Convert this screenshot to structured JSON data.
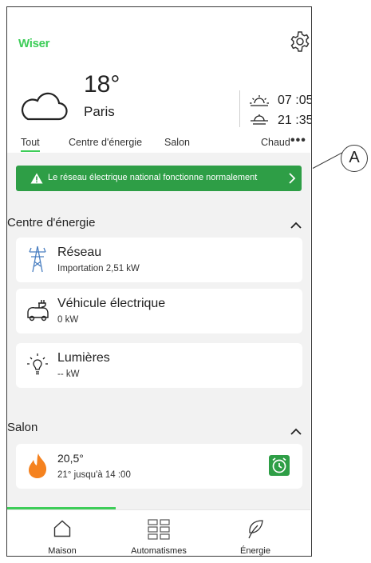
{
  "header": {
    "logo": "Wiser",
    "weather": {
      "icon": "cloud-icon",
      "temperature": "18°",
      "city": "Paris"
    },
    "sunrise": {
      "icon": "sunrise-icon",
      "time": "07 :05"
    },
    "sunset": {
      "icon": "sunset-icon",
      "time": "21 :35"
    },
    "settings_icon": "gear-icon"
  },
  "tabs": [
    {
      "label": "Tout",
      "active": true
    },
    {
      "label": "Centre d'énergie"
    },
    {
      "label": "Salon"
    },
    {
      "label": "Chaud"
    }
  ],
  "more_label": "•••",
  "banner": {
    "text": "Le réseau électrique national fonctionne normalement",
    "icon": "warning-icon"
  },
  "energy_section": {
    "title": "Centre d'énergie",
    "cards": [
      {
        "icon": "power-tower-icon",
        "title": "Réseau",
        "subtitle": "Importation 2,51 kW"
      },
      {
        "icon": "ev-charger-icon",
        "title": "Véhicule électrique",
        "subtitle": "0 kW"
      },
      {
        "icon": "light-bulb-icon",
        "title": "Lumières",
        "subtitle": "-- kW"
      }
    ]
  },
  "salon_section": {
    "title": "Salon",
    "card": {
      "icon": "flame-icon",
      "temperature": "20,5°",
      "schedule": "21° jusqu'à 14 :00",
      "action_icon": "timer-icon"
    }
  },
  "bottom_nav": [
    {
      "label": "Maison",
      "icon": "home-icon",
      "active": true
    },
    {
      "label": "Automatismes",
      "icon": "grid-icon"
    },
    {
      "label": "Énergie",
      "icon": "leaf-icon"
    }
  ],
  "callout": "A",
  "colors": {
    "accent": "#3dcd58",
    "banner": "#2e9e46",
    "flame": "#f5821f",
    "background": "#f2f2f2"
  }
}
